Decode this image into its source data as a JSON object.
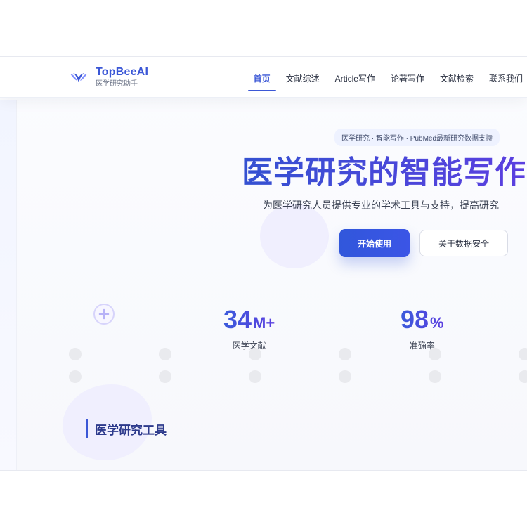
{
  "brand": {
    "name": "TopBeeAI",
    "subtitle": "医学研究助手"
  },
  "nav": {
    "items": [
      {
        "label": "首页",
        "active": true
      },
      {
        "label": "文献综述",
        "active": false
      },
      {
        "label": "Article写作",
        "active": false
      },
      {
        "label": "论著写作",
        "active": false
      },
      {
        "label": "文献检索",
        "active": false
      },
      {
        "label": "联系我们",
        "active": false
      }
    ]
  },
  "hero": {
    "badge": "医学研究 · 智能写作 · PubMed最新研究数据支持",
    "title": "医学研究的智能写作",
    "subtitle": "为医学研究人员提供专业的学术工具与支持，提高研究",
    "primary_button": "开始使用",
    "secondary_button": "关于数据安全"
  },
  "stats": [
    {
      "value": "34",
      "suffix": "M+",
      "label": "医学文献"
    },
    {
      "value": "98",
      "suffix": "%",
      "label": "准确率"
    }
  ],
  "section": {
    "title": "医学研究工具"
  },
  "colors": {
    "brand": "#3b57d6",
    "brand_gradient_end": "#5b3fe0",
    "chip_bg": "#eef2ff",
    "lavender": "#efeefe"
  },
  "icons": {
    "logo": "wing-logo-icon",
    "plus": "plus-circle-icon"
  }
}
